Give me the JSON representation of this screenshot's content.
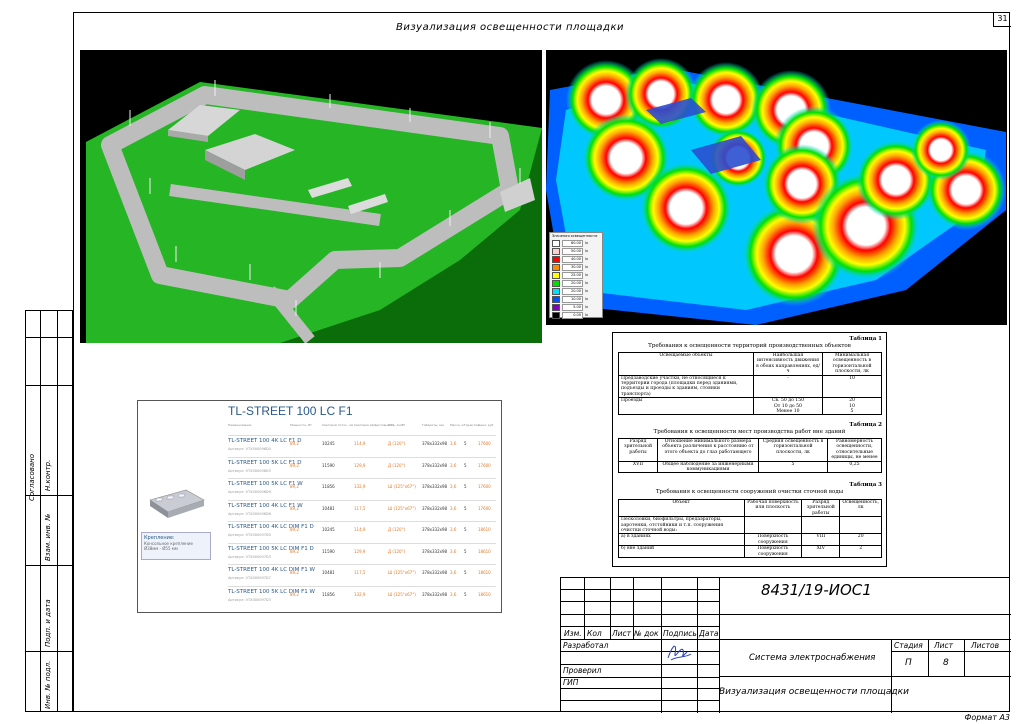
{
  "sheet": {
    "title": "Визуализация освещенности площадки",
    "sheet_number": "31",
    "format": "Формат А3"
  },
  "side_stamp": {
    "agreed": "Согласовано",
    "n_control": "Н.контр.",
    "replace_inv": "Взам. инв. №",
    "sign_date": "Подп. и дата",
    "inv_orig": "Инв. № подл."
  },
  "legend": {
    "title": "Значения освещенности",
    "unit": "lx",
    "items": [
      {
        "value": "60.00",
        "color": "#ffffff"
      },
      {
        "value": "50.00",
        "color": "#ffd0d0"
      },
      {
        "value": "40.00",
        "color": "#ff0000"
      },
      {
        "value": "30.00",
        "color": "#ff8c00"
      },
      {
        "value": "25.00",
        "color": "#ffff00"
      },
      {
        "value": "20.00",
        "color": "#00e000"
      },
      {
        "value": "20.00",
        "color": "#00e0ff"
      },
      {
        "value": "10.00",
        "color": "#0050ff"
      },
      {
        "value": "5.00",
        "color": "#8000c0"
      },
      {
        "value": "0.00",
        "color": "#000000"
      }
    ]
  },
  "catalog": {
    "title": "TL-STREET 100 LC F1",
    "headers": [
      "Наименование",
      "Мощность, Вт",
      "Световой поток, лм",
      "Световая эффективность, лм/Вт",
      "КСС",
      "Габариты, мм",
      "Масса, кг",
      "Гарантия",
      "Цена, руб"
    ],
    "mount_title": "Крепление:",
    "mount_text": "Консольное крепление Ø38мм - Ø55 мм",
    "rows": [
      {
        "name": "TL-STREET 100 4K LC F1 D",
        "article": "Артикул: VTX000096D0",
        "power": "89,2",
        "flux": "10245",
        "eff": "114,9",
        "kss": "Д (120°)",
        "dims": "378х332х98",
        "mass": "3,6",
        "warranty": "5",
        "price": "17600"
      },
      {
        "name": "TL-STREET 100 5K LC F1 D",
        "article": "Артикул: VTX000096D3",
        "power": "89,2",
        "flux": "11590",
        "eff": "129,9",
        "kss": "Д (120°)",
        "dims": "378х332х98",
        "mass": "3,6",
        "warranty": "5",
        "price": "17600"
      },
      {
        "name": "TL-STREET 100 5K LC F1 W",
        "article": "Артикул: VTX000096D9",
        "power": "89,2",
        "flux": "11856",
        "eff": "132,9",
        "kss": "Ш (125°х67°)",
        "dims": "378х332х98",
        "mass": "3,6",
        "warranty": "5",
        "price": "17600"
      },
      {
        "name": "TL-STREET 100 4K LC F1 W",
        "article": "Артикул: VTX000096D6",
        "power": "89,2",
        "flux": "10481",
        "eff": "117,5",
        "kss": "Ш (125°х67°)",
        "dims": "378х332х98",
        "mass": "3,6",
        "warranty": "5",
        "price": "17600"
      },
      {
        "name": "TL-STREET 100 4K LC DIM F1 D",
        "article": "Артикул: VTX000097D0",
        "power": "89,2",
        "flux": "10245",
        "eff": "114,9",
        "kss": "Д (120°)",
        "dims": "378х332х98",
        "mass": "3,6",
        "warranty": "5",
        "price": "18610"
      },
      {
        "name": "TL-STREET 100 5K LC DIM F1 D",
        "article": "Артикул: VTX000097D3",
        "power": "89,2",
        "flux": "11590",
        "eff": "129,9",
        "kss": "Д (120°)",
        "dims": "378х332х98",
        "mass": "3,6",
        "warranty": "5",
        "price": "18610"
      },
      {
        "name": "TL-STREET 100 4K LC DIM F1 W",
        "article": "Артикул: VTX000097D7",
        "power": "89,2",
        "flux": "10481",
        "eff": "117,5",
        "kss": "Ш (125°х67°)",
        "dims": "378х332х98",
        "mass": "3,6",
        "warranty": "5",
        "price": "18610"
      },
      {
        "name": "TL-STREET 100 5K LC DIM F1 W",
        "article": "Артикул: VTX000097D3",
        "power": "89,2",
        "flux": "11856",
        "eff": "132,9",
        "kss": "Ш (125°х67°)",
        "dims": "378х332х98",
        "mass": "3,6",
        "warranty": "5",
        "price": "18610"
      }
    ]
  },
  "requirements": {
    "t1_label": "Таблица 1",
    "t1_title": "Требования к освещенности территорий производственных объектов",
    "t1_head": [
      "Освещаемые объекты",
      "Наибольшая интенсивность движения в обоих направлениях, ед/ч",
      "Минимальная освещенность в горизонтальной плоскости, лк"
    ],
    "t1_r1": [
      "Предзаводские участки, не относящиеся к территории города (площадки перед зданиями, подъезды и проезды к зданиям, стоянки транспорта)",
      "-",
      "10"
    ],
    "t1_r2_label": "Проезды",
    "t1_r2_mid": [
      "Св. 50 до 150",
      "От 10 до 50",
      "Менее 10"
    ],
    "t1_r2_val": [
      "20",
      "10",
      "5"
    ],
    "t2_label": "Таблица 2",
    "t2_title": "Требования к освещенности мест производства работ вне зданий",
    "t2_head": [
      "Разряд зрительной работы",
      "Отношение минимального размера объекта различения к расстоянию от этого объекта до глаз работающего",
      "Средняя освещенность в горизонтальной плоскости, лк",
      "Равномерность освещенности, относительные единицы, не менее"
    ],
    "t2_r1": [
      "XVII",
      "Общее наблюдение за инженерными коммуникациями",
      "5",
      "0,25"
    ],
    "t3_label": "Таблица 3",
    "t3_title": "Требования к освещенности сооружений очистки сточной воды",
    "t3_head": [
      "Объект",
      "Рабочая поверхность или плоскость",
      "Разряд зрительной работы",
      "Освещенность, лк"
    ],
    "t3_r0": "Песколовки, биофильтры, предаэраторы, аэротенки, отстойники и т.п. сооружения очистки сточной воды:",
    "t3_r1": [
      "а) в зданиях",
      "Поверхность сооружения",
      "VIII",
      "20"
    ],
    "t3_r2": [
      "б) вне зданий",
      "Поверхность сооружения",
      "XIV",
      "2"
    ]
  },
  "title_block": {
    "code": "8431/19-ИОС1",
    "izm": "Изм.",
    "kol": "Кол",
    "list": "Лист",
    "ndoc": "№ док",
    "podpis": "Подпись",
    "data": "Дата",
    "razrabotal": "Разработал",
    "proveril": "Проверил",
    "gip": "ГИП",
    "system": "Система электроснабжения",
    "stadia_h": "Стадия",
    "list_h": "Лист",
    "listov_h": "Листов",
    "stadia": "П",
    "list_no": "8",
    "drawing": "Визуализация освещенности площадки"
  }
}
